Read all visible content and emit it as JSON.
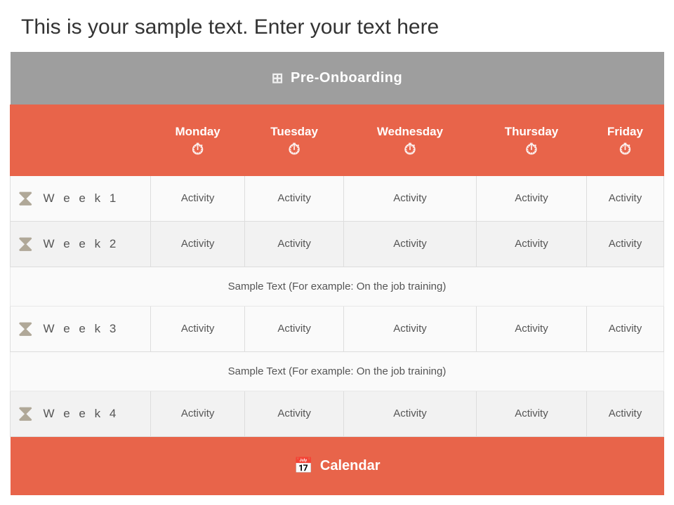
{
  "page": {
    "sample_text": "This is your sample text. Enter your text here",
    "section_title": "Pre-Onboarding",
    "days": [
      "Monday",
      "Tuesday",
      "Wednesday",
      "Thursday",
      "Friday"
    ],
    "weeks": [
      {
        "label": "W e e k  1",
        "activities": [
          "Activity",
          "Activity",
          "Activity",
          "Activity",
          "Activity"
        ]
      },
      {
        "label": "W e e k  2",
        "activities": [
          "Activity",
          "Activity",
          "Activity",
          "Activity",
          "Activity"
        ],
        "sample_note": "Sample Text (For example: On the job training)"
      },
      {
        "label": "W e e k  3",
        "activities": [
          "Activity",
          "Activity",
          "Activity",
          "Activity",
          "Activity"
        ],
        "sample_note": "Sample Text (For example: On the job training)"
      },
      {
        "label": "W e e k  4",
        "activities": [
          "Activity",
          "Activity",
          "Activity",
          "Activity",
          "Activity"
        ]
      }
    ],
    "footer_label": "Calendar",
    "colors": {
      "header_bg": "#9e9e9e",
      "accent": "#e8644a",
      "text_dark": "#333",
      "text_mid": "#555"
    }
  }
}
